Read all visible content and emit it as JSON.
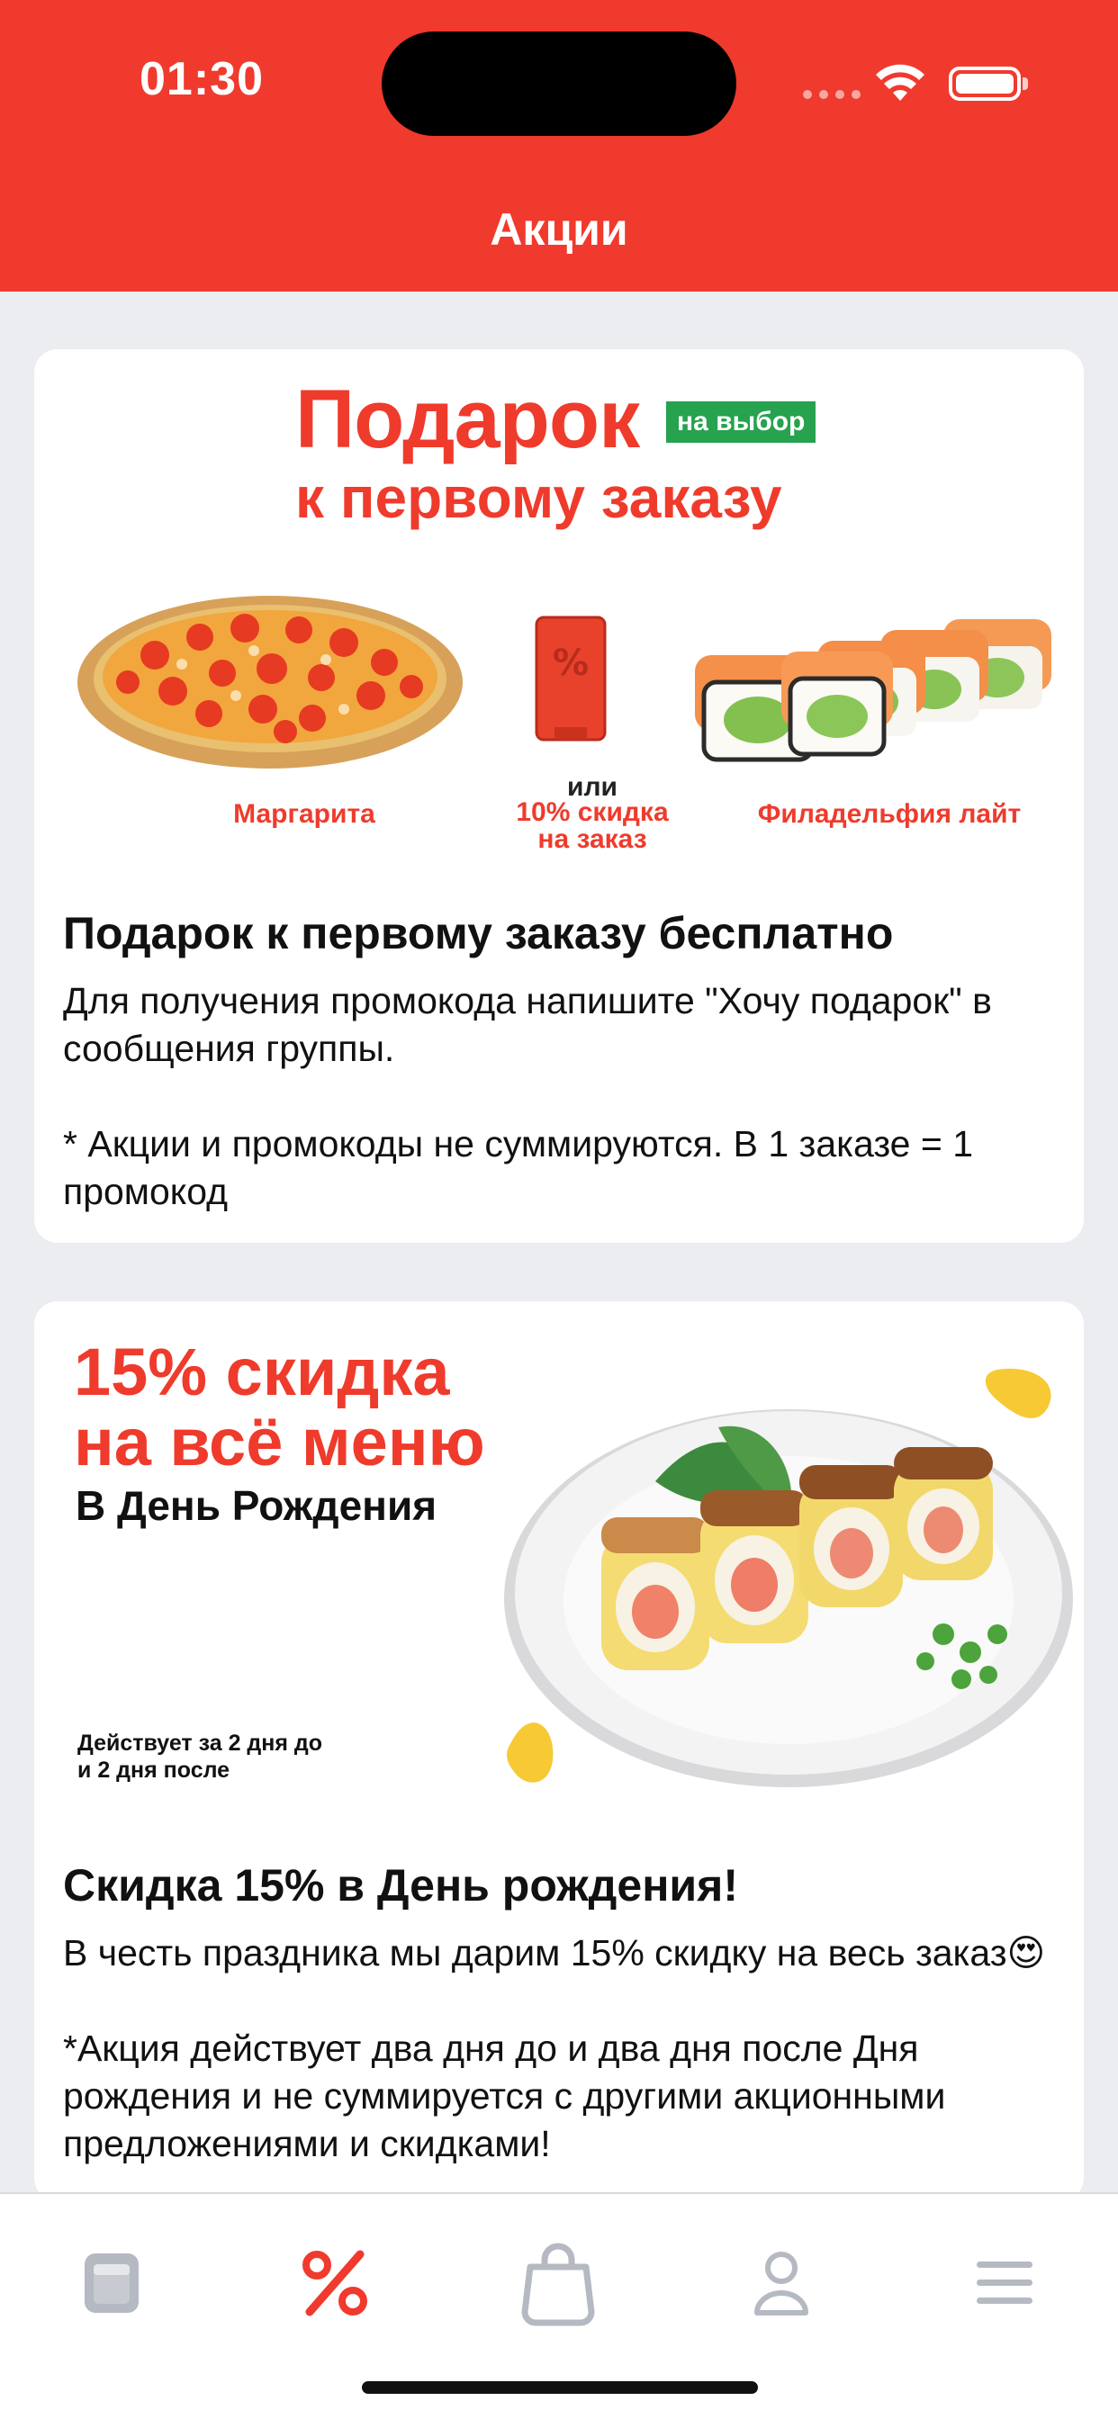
{
  "status_bar": {
    "time": "01:30"
  },
  "header": {
    "title": "Акции"
  },
  "promos": [
    {
      "banner": {
        "headline": "Подарок",
        "tag": "на выбор",
        "subheadline": "к первому заказу",
        "options": [
          {
            "label": "Маргарита"
          },
          {
            "connector": "или",
            "label": "10% скидка на заказ"
          },
          {
            "label": "Филадельфия лайт"
          }
        ]
      },
      "title": "Подарок к первому заказу бесплатно",
      "description": "Для получения промокода напишите \"Хочу подарок\" в сообщения группы.\n\n* Акции и промокоды не суммируются. В 1 заказе = 1 промокод"
    },
    {
      "banner": {
        "headline": "15% скидка\nна всё меню",
        "subheadline": "В День Рождения",
        "note": "Действует за 2 дня до\nи 2 дня после"
      },
      "title": "Скидка 15% в День рождения!",
      "description": "В честь праздника мы дарим 15% скидку на весь заказ😍\n\n*Акция действует два дня до и два дня после Дня рождения и не суммируется с другими акционными предложениями и скидками!"
    }
  ],
  "tab_bar": {
    "active": "promotions",
    "tabs": [
      {
        "id": "menu",
        "icon": "menu-book-icon"
      },
      {
        "id": "promotions",
        "icon": "percent-icon"
      },
      {
        "id": "cart",
        "icon": "shopping-bag-icon"
      },
      {
        "id": "profile",
        "icon": "profile-icon"
      },
      {
        "id": "more",
        "icon": "hamburger-icon"
      }
    ]
  },
  "colors": {
    "brand": "#f03a2d",
    "tag_green": "#27a24f",
    "inactive_icon": "#b5b9c2"
  }
}
